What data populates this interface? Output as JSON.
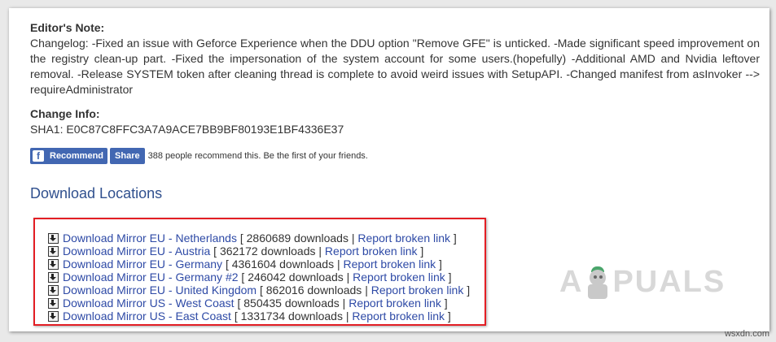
{
  "editor_note": {
    "heading": "Editor's Note:",
    "text": "Changelog: -Fixed an issue with Geforce Experience when the DDU option \"Remove GFE\" is unticked. -Made significant speed improvement on the registry clean-up part. -Fixed the impersonation of the system account for some users.(hopefully) -Additional AMD and Nvidia leftover removal. -Release SYSTEM token after cleaning thread is complete to avoid weird issues with SetupAPI. -Changed manifest from asInvoker --> requireAdministrator"
  },
  "change_info": {
    "heading": "Change Info:",
    "sha": "SHA1: E0C87C8FFC3A7A9ACE7BB9BF80193E1BF4336E37"
  },
  "social": {
    "recommend_label": "Recommend",
    "share_label": "Share",
    "text": "388 people recommend this. Be the first of your friends.",
    "brand_color": "#4267b2"
  },
  "downloads": {
    "title": "Download Locations",
    "report_label": "Report broken link",
    "mirrors": [
      {
        "name": "Download Mirror EU - Netherlands",
        "count": "2860689 downloads"
      },
      {
        "name": "Download Mirror EU - Austria",
        "count": "362172 downloads"
      },
      {
        "name": "Download Mirror EU - Germany",
        "count": "4361604 downloads"
      },
      {
        "name": "Download Mirror EU - Germany #2",
        "count": "246042 downloads"
      },
      {
        "name": "Download Mirror EU - United Kingdom",
        "count": "862016 downloads"
      },
      {
        "name": "Download Mirror US - West Coast",
        "count": "850435 downloads"
      },
      {
        "name": "Download Mirror US - East Coast",
        "count": "1331734 downloads"
      }
    ],
    "highlight_color": "#e31e24"
  },
  "watermark": {
    "left": "A",
    "right": "PUALS"
  },
  "site_mark": "wsxdn.com"
}
